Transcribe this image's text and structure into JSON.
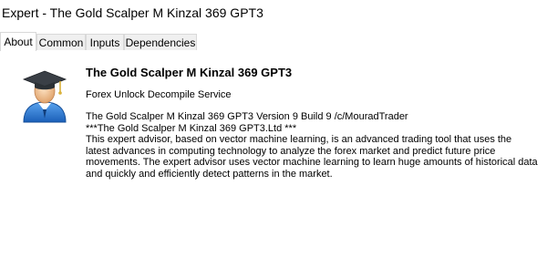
{
  "window": {
    "title": "Expert - The Gold Scalper M Kinzal 369 GPT3"
  },
  "tabs": [
    {
      "label": "About",
      "active": true
    },
    {
      "label": "Common",
      "active": false
    },
    {
      "label": "Inputs",
      "active": false
    },
    {
      "label": "Dependencies",
      "active": false
    }
  ],
  "about": {
    "logo_icon": "graduate-user-icon",
    "name": "The Gold Scalper M Kinzal 369 GPT3",
    "subtitle": "Forex Unlock Decompile Service",
    "description_lines": [
      " The Gold Scalper M Kinzal 369 GPT3 Version 9 Build 9 /c/MouradTrader",
      " ***The Gold Scalper M Kinzal 369 GPT3.Ltd ***",
      "  This expert advisor, based on vector machine learning, is an advanced trading tool that uses the",
      "latest advances in computing technology to analyze the forex market and predict future price",
      "movements. The expert advisor uses vector machine learning to learn huge amounts of historical data",
      "and quickly and efficiently detect patterns in the market."
    ]
  }
}
